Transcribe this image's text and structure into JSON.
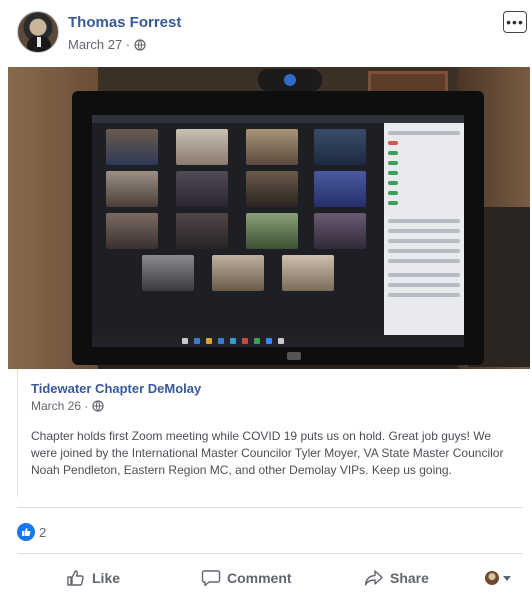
{
  "post": {
    "author": "Thomas Forrest",
    "date": "March 27 ·",
    "more_icon": "ellipsis-icon",
    "privacy_icon": "globe-icon"
  },
  "shared_post": {
    "page_name": "Tidewater Chapter DeMolay",
    "date": "March 26 ·",
    "text": "Chapter holds first Zoom meeting while COVID 19 puts us on hold. Great job guys! We were joined by the International Master Councilor Tyler Moyer, VA State Master Councilor Noah Pendleton, Eastern Region MC, and other Demolay VIPs. Keep us going."
  },
  "reactions": {
    "count": "2",
    "icon": "thumbs-up-icon",
    "color": "#1877f2"
  },
  "actions": {
    "like_label": "Like",
    "comment_label": "Comment",
    "share_label": "Share"
  },
  "colors": {
    "name_link": "#385898",
    "secondary_text": "#606770"
  }
}
